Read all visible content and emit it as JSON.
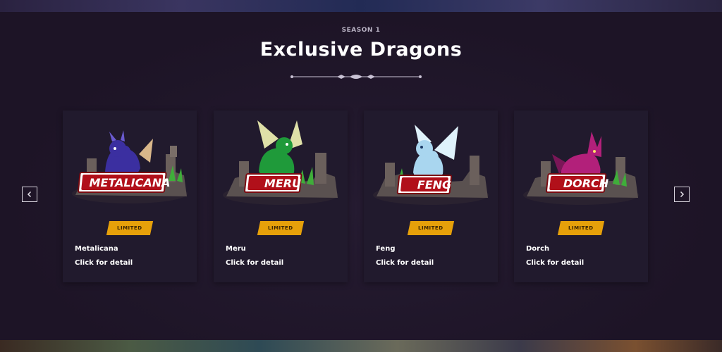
{
  "section": {
    "eyebrow": "SEASON 1",
    "title": "Exclusive Dragons"
  },
  "carousel": {
    "prev_icon": "chevron-left-icon",
    "next_icon": "chevron-right-icon",
    "cards": [
      {
        "art_label": "METALICANA",
        "badge": "LIMITED",
        "name": "Metalicana",
        "detail": "Click for detail",
        "dragon_color": "#3b2fa0",
        "wing_color": "#d9b78a"
      },
      {
        "art_label": "MERU",
        "badge": "LIMITED",
        "name": "Meru",
        "detail": "Click for detail",
        "dragon_color": "#1f9a3a",
        "wing_color": "#dfe0a8"
      },
      {
        "art_label": "FENG",
        "badge": "LIMITED",
        "name": "Feng",
        "detail": "Click for detail",
        "dragon_color": "#a9d6ef",
        "wing_color": "#dff2fb"
      },
      {
        "art_label": "DORCH",
        "badge": "LIMITED",
        "name": "Dorch",
        "detail": "Click for detail",
        "dragon_color": "#b2207a",
        "wing_color": "#7a1657"
      }
    ]
  },
  "colors": {
    "background": "#1d1426",
    "card": "#211a2d",
    "badge": "#e6a00a",
    "label_red": "#b1101a"
  }
}
